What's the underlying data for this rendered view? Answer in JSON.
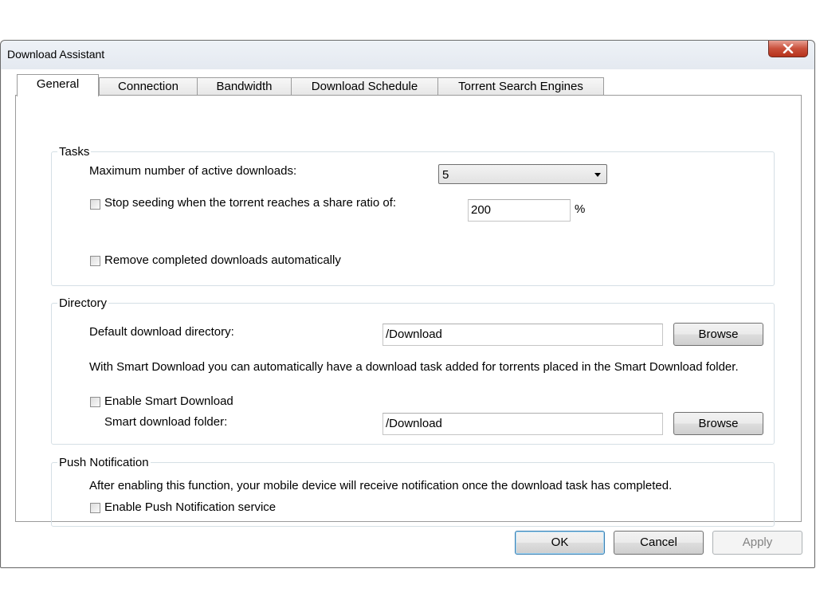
{
  "window": {
    "title": "Download Assistant"
  },
  "tabs": [
    {
      "label": "General",
      "selected": true
    },
    {
      "label": "Connection",
      "selected": false
    },
    {
      "label": "Bandwidth",
      "selected": false
    },
    {
      "label": "Download Schedule",
      "selected": false
    },
    {
      "label": "Torrent Search Engines",
      "selected": false
    }
  ],
  "tasks": {
    "title": "Tasks",
    "max_downloads_label": "Maximum number of active downloads:",
    "max_downloads_value": "5",
    "stop_seeding_label": "Stop seeding when the torrent reaches a share ratio of:",
    "stop_seeding_checked": false,
    "share_ratio_value": "200",
    "share_ratio_unit": "%",
    "remove_completed_label": "Remove completed downloads automatically",
    "remove_completed_checked": false
  },
  "directory": {
    "title": "Directory",
    "default_dir_label": "Default download directory:",
    "default_dir_value": "/Download",
    "browse_label": "Browse",
    "smart_info": "With Smart Download you can automatically have a download task added for torrents placed in the Smart Download folder.",
    "enable_smart_label": "Enable Smart Download",
    "enable_smart_checked": false,
    "smart_folder_label": "Smart download folder:",
    "smart_folder_value": "/Download",
    "browse_label_2": "Browse"
  },
  "push": {
    "title": "Push Notification",
    "info": "After enabling this function, your mobile device will receive notification once the download task has completed.",
    "enable_label": "Enable Push Notification service",
    "enable_checked": false
  },
  "footer": {
    "ok_label": "OK",
    "cancel_label": "Cancel",
    "apply_label": "Apply"
  },
  "icons": {
    "close": "close-icon",
    "dropdown": "chevron-down-icon"
  }
}
